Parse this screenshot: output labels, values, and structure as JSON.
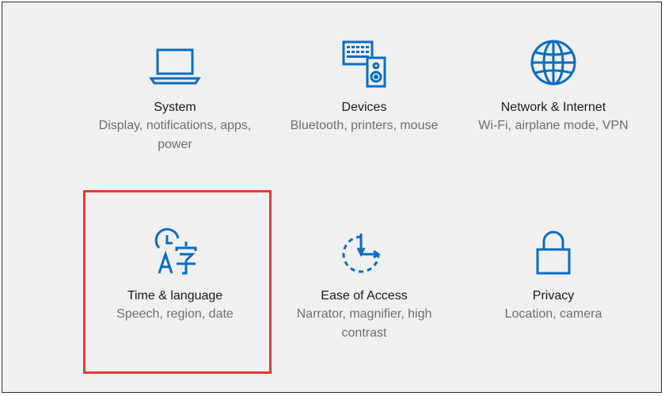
{
  "accent_color": "#0a6cc5",
  "highlight_color": "#e53935",
  "tiles": [
    {
      "title": "System",
      "desc": "Display, notifications, apps, power",
      "icon": "laptop-icon"
    },
    {
      "title": "Devices",
      "desc": "Bluetooth, printers, mouse",
      "icon": "keyboard-speaker-icon"
    },
    {
      "title": "Network & Internet",
      "desc": "Wi-Fi, airplane mode, VPN",
      "icon": "globe-icon"
    },
    {
      "title": "Time & language",
      "desc": "Speech, region, date",
      "icon": "time-language-icon"
    },
    {
      "title": "Ease of Access",
      "desc": "Narrator, magnifier, high contrast",
      "icon": "ease-of-access-icon"
    },
    {
      "title": "Privacy",
      "desc": "Location, camera",
      "icon": "lock-icon"
    }
  ]
}
